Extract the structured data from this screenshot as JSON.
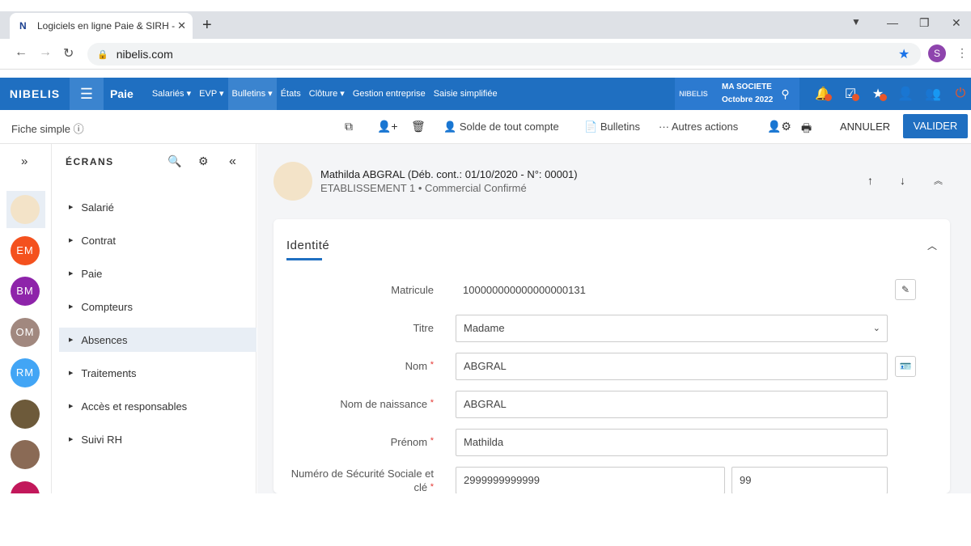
{
  "browser": {
    "tab_title": "Logiciels en ligne Paie & SIRH - N",
    "tab_favicon": "N",
    "url": "nibelis.com",
    "profile_initial": "S"
  },
  "app": {
    "logo": "NIBELIS",
    "name": "Paie",
    "menu": [
      "Salariés ▾",
      "EVP ▾",
      "Bulletins ▾",
      "États",
      "Clôture ▾",
      "Gestion entreprise",
      "Saisie simplifiée"
    ],
    "active_menu": "Bulletins ▾",
    "company": "MA SOCIETE",
    "period": "Octobre 2022",
    "company_logo": "NIBELIS"
  },
  "toolbar": {
    "left": "Fiche simple",
    "solde": "Solde de tout compte",
    "bulletins": "Bulletins",
    "autres": "Autres actions",
    "annuler": "ANNULER",
    "valider": "VALIDER"
  },
  "avatars": [
    {
      "initials": "",
      "color": "#f3e3c8"
    },
    {
      "initials": "EM",
      "color": "#f4511e"
    },
    {
      "initials": "BM",
      "color": "#8e24aa"
    },
    {
      "initials": "OM",
      "color": "#a1887f"
    },
    {
      "initials": "RM",
      "color": "#42a5f5"
    }
  ],
  "screens": {
    "header": "ÉCRANS",
    "items": [
      "Salarié",
      "Contrat",
      "Paie",
      "Compteurs",
      "Absences",
      "Traitements",
      "Accès et responsables",
      "Suivi RH"
    ],
    "selected": "Absences"
  },
  "employee": {
    "name": "Mathilda ABGRAL (Déb. cont.: 01/10/2020 - N°: 00001)",
    "subtitle": "ETABLISSEMENT 1 • Commercial Confirmé"
  },
  "identite": {
    "title": "Identité",
    "matricule_label": "Matricule",
    "matricule_value": "100000000000000000131",
    "titre_label": "Titre",
    "titre_value": "Madame",
    "nom_label": "Nom",
    "nom_value": "ABGRAL",
    "naissance_label": "Nom de naissance",
    "naissance_value": "ABGRAL",
    "prenom_label": "Prénom",
    "prenom_value": "Mathilda",
    "nss_label_1": "Numéro de Sécurité Sociale et",
    "nss_label_2": "clé",
    "nss_value": "2999999999999",
    "nss_key": "99"
  }
}
